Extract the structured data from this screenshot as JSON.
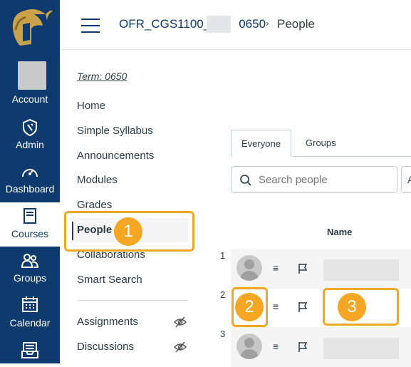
{
  "global_nav": {
    "account_label": "Account",
    "admin_label": "Admin",
    "dashboard_label": "Dashboard",
    "courses_label": "Courses",
    "groups_label": "Groups",
    "calendar_label": "Calendar"
  },
  "header": {
    "course_code": "OFR_CGS1100_",
    "course_suffix": "0650",
    "separator": "›",
    "page_title": "People"
  },
  "course_nav": {
    "term": "Term: 0650",
    "items": [
      "Home",
      "Simple Syllabus",
      "Announcements",
      "Modules",
      "Grades",
      "People",
      "Collaborations",
      "Smart Search"
    ],
    "hidden_items": [
      "Assignments",
      "Discussions"
    ]
  },
  "people": {
    "tabs": [
      "Everyone",
      "Groups"
    ],
    "search_placeholder": "Search people",
    "role_select_partial": "A",
    "column_name": "Name",
    "rows": [
      {
        "num": "1"
      },
      {
        "num": "2"
      },
      {
        "num": "3"
      }
    ],
    "menu_glyph": "≡"
  },
  "callouts": [
    "1",
    "2",
    "3"
  ],
  "colors": {
    "nav_bg": "#0e3a6e",
    "callout": "#f5a623"
  }
}
